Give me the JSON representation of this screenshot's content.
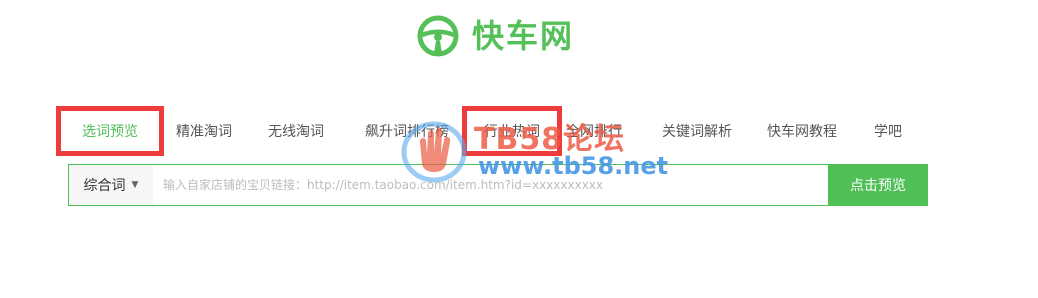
{
  "brand": {
    "logo_text": "快车网",
    "color": "#55c058"
  },
  "tabs": [
    {
      "label": "选词预览",
      "active": true,
      "highlighted": true
    },
    {
      "label": "精准淘词",
      "active": false
    },
    {
      "label": "无线淘词",
      "active": false
    },
    {
      "label": "飙升词排行榜",
      "active": false
    },
    {
      "label": "行业热词",
      "active": false,
      "highlighted": true
    },
    {
      "label": "全网排行",
      "active": false
    },
    {
      "label": "关键词解析",
      "active": false
    },
    {
      "label": "快车网教程",
      "active": false
    },
    {
      "label": "学吧",
      "active": false
    }
  ],
  "search": {
    "type_label": "综合词",
    "placeholder": "输入自家店铺的宝贝链接：http://item.taobao.com/item.htm?id=xxxxxxxxxx",
    "button_label": "点击预览"
  },
  "watermark": {
    "title": "TB58论坛",
    "url": "www.tb58.net"
  },
  "colors": {
    "accent": "#4fbf56",
    "highlight_box": "#ee3b3b"
  }
}
